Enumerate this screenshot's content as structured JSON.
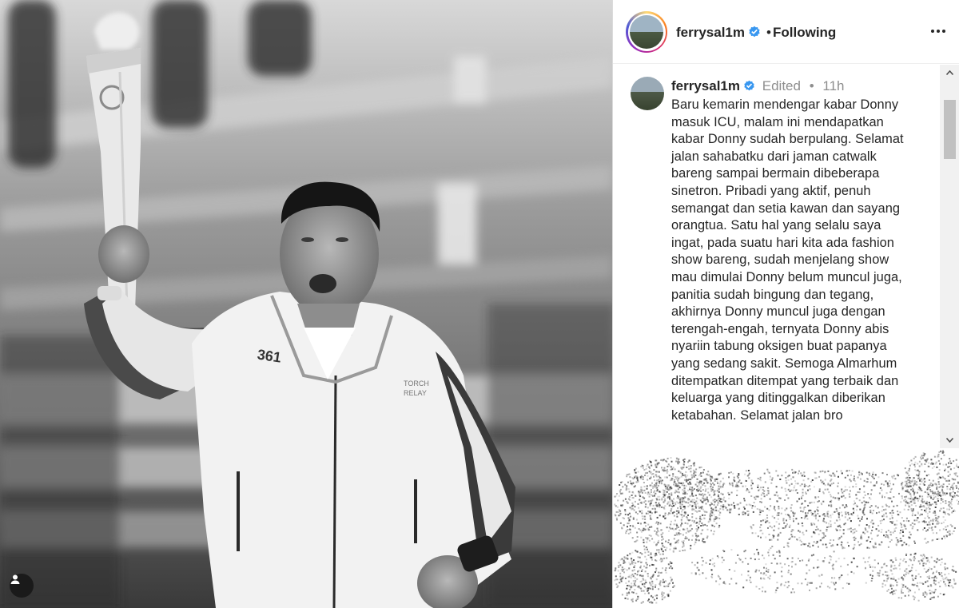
{
  "post": {
    "username": "ferrysal1m",
    "follow_status": "Following",
    "header_separator": "•",
    "verified": true
  },
  "caption": {
    "username": "ferrysal1m",
    "edited_label": "Edited",
    "separator": "•",
    "time_ago": "11h",
    "text": "Baru kemarin mendengar kabar Donny\nmasuk ICU, malam ini mendapatkan\nkabar Donny sudah berpulang. Selamat\njalan sahabatku dari jaman catwalk\nbareng sampai bermain dibeberapa\nsinetron. Pribadi yang aktif, penuh\nsemangat dan setia kawan dan sayang\norangtua. Satu hal yang selalu saya\ningat, pada suatu hari kita ada fashion\nshow bareng, sudah menjelang show\nmau dimulai Donny belum muncul juga,\npanitia sudah bingung dan tegang,\nakhirnya Donny muncul juga dengan\nterengah-engah, ternyata Donny abis\nnyariin tabung oksigen buat papanya\nyang sedang sakit. Semoga Almarhum\nditempatkan ditempat yang terbaik dan\nkeluarga yang ditinggalkan diberikan\nketabahan. Selamat jalan bro"
  },
  "photo": {
    "jacket_print": "361",
    "chest_logo_line1": "TORCH",
    "chest_logo_line2": "RELAY"
  },
  "icons": {
    "more": "more-options-icon",
    "verified": "verified-badge-icon",
    "tagged_users": "user-tag-icon",
    "scroll_up": "scroll-up-arrow-icon",
    "scroll_down": "scroll-down-arrow-icon"
  },
  "colors": {
    "verified_blue": "#3897f0",
    "text": "#262626",
    "muted": "#8e8e8e"
  }
}
